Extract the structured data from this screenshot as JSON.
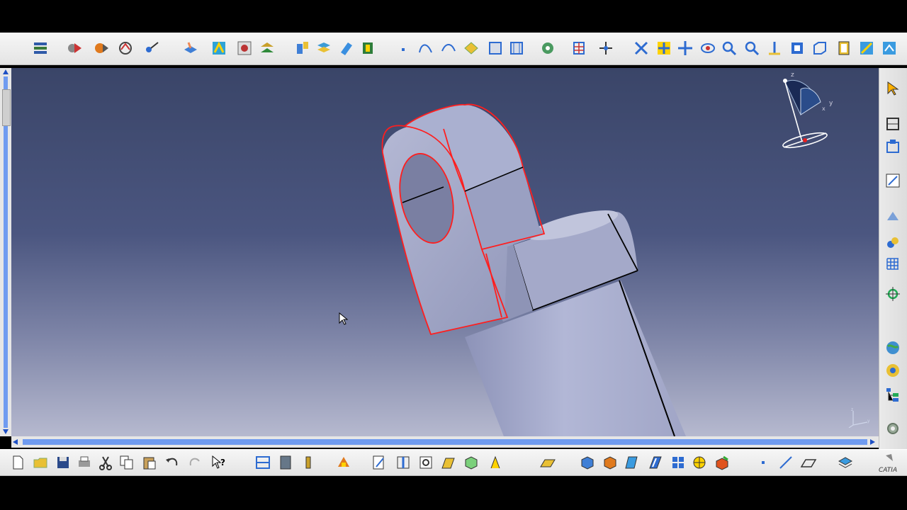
{
  "app": {
    "name": "CATIA",
    "logo_text": "CATIA"
  },
  "top_toolbar": {
    "icons": [
      "update-icon",
      "knowledge-icon",
      "publish-icon",
      "formula-icon",
      "pointer-icon",
      "pad-icon",
      "shaft-icon",
      "hole-icon",
      "rib-icon",
      "edge-fillet-icon",
      "chamfer-icon",
      "draft-icon",
      "shell-icon",
      "point-icon",
      "spline-icon",
      "curve-icon",
      "boolean-icon",
      "axis-system-icon",
      "sketcher-grid-icon",
      "measure-icon",
      "fly-mode-icon",
      "fit-all-icon",
      "pan-icon",
      "rotate-icon",
      "zoom-in-icon",
      "zoom-out-icon",
      "normal-view-icon",
      "quick-view-icon",
      "view-mode-icon",
      "hide-show-icon",
      "swap-space-icon",
      "render-style-icon"
    ]
  },
  "bottom_toolbar": {
    "icons": [
      "new-icon",
      "open-icon",
      "save-icon",
      "print-icon",
      "cut-icon",
      "copy-icon",
      "paste-icon",
      "undo-icon",
      "redo-icon",
      "whats-this-icon",
      "tools-icon",
      "catalog-icon",
      "light-icon",
      "macro-icon",
      "sketch-icon",
      "split-icon",
      "thickness-icon",
      "translate-icon",
      "shape-fillet-icon",
      "knowledge-advisor-icon",
      "plane-icon",
      "part-body-icon",
      "solid-icon",
      "fill-icon",
      "sweep-icon",
      "pattern-icon",
      "mirror-icon",
      "material-icon",
      "point-small-icon",
      "line-icon",
      "plane-small-icon",
      "layer-icon"
    ]
  },
  "right_toolbar": {
    "icons": [
      "select-icon",
      "sketch-tools-icon",
      "constraint-icon",
      "sketch-icon",
      "projection-icon",
      "operation-icon",
      "grid-icon",
      "analysis-icon",
      "apply-material-icon",
      "render-icon",
      "tree-icon",
      "settings-icon"
    ]
  },
  "compass": {
    "axes": [
      "z",
      "y",
      "x"
    ]
  },
  "viewport": {
    "colors": {
      "background_top": "#3a4568",
      "background_bottom": "#b6b9cf",
      "part": "#9aa0c4",
      "highlight": "#ff2020"
    }
  }
}
